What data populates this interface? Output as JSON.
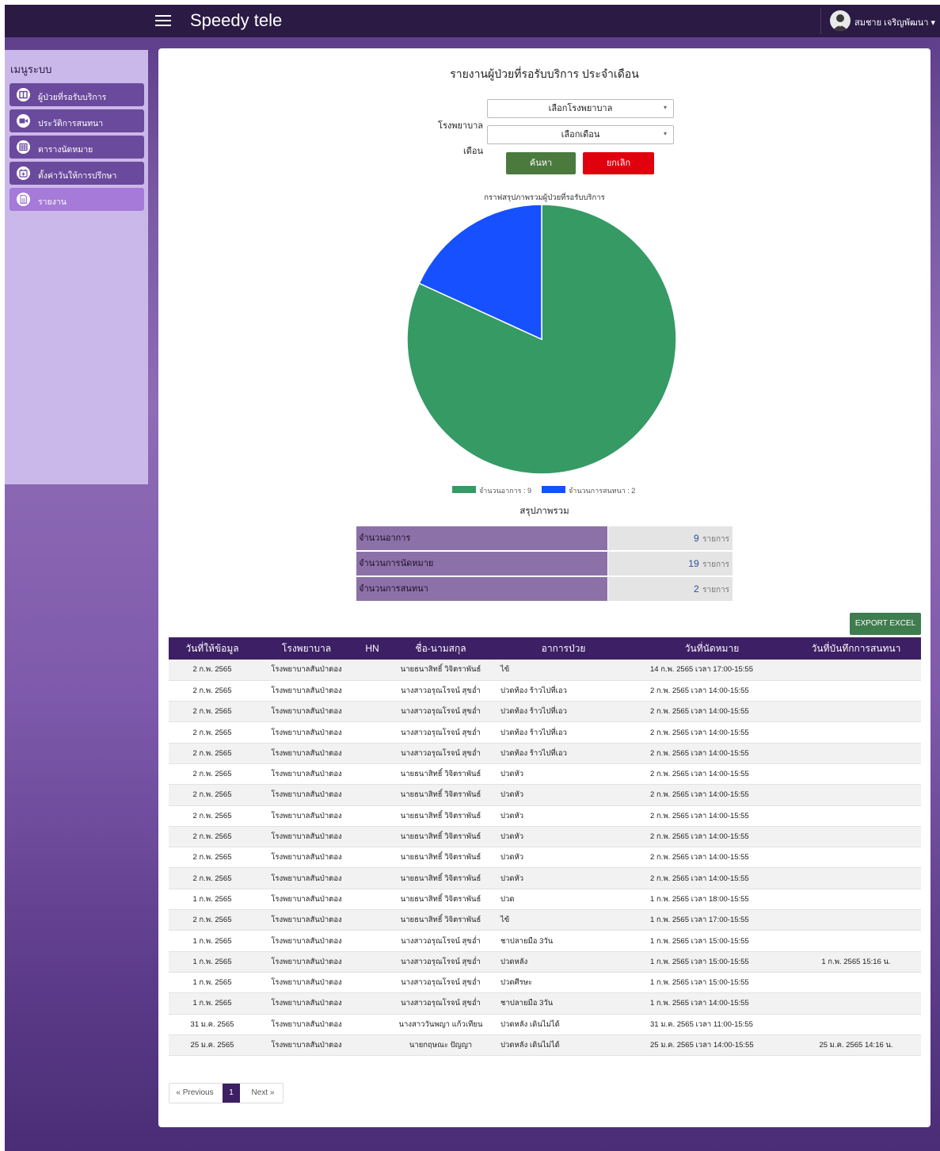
{
  "app": {
    "title": "Speedy tele"
  },
  "user": {
    "name": "สมชาย เจริญพัฒนา ▾"
  },
  "sidebar": {
    "title": "เมนูระบบ",
    "items": [
      {
        "label": "ผู้ป่วยที่รอรับบริการ",
        "icon": "columns-icon"
      },
      {
        "label": "ประวัติการสนทนา",
        "icon": "video-camera-icon"
      },
      {
        "label": "ตารางนัดหมาย",
        "icon": "table-icon"
      },
      {
        "label": "ตั้งค่าวันให้การปรึกษา",
        "icon": "calendar-plus-icon"
      },
      {
        "label": "รายงาน",
        "icon": "document-icon"
      }
    ]
  },
  "report": {
    "title": "รายงานผู้ป่วยที่รอรับบริการ ประจำเดือน",
    "hospital_label": "โรงพยาบาล",
    "hospital_value": "เลือกโรงพยาบาล",
    "month_label": "เดือน",
    "month_value": "เลือกเดือน",
    "search_label": "ค้นหา",
    "cancel_label": "ยกเลิก"
  },
  "chart_data": {
    "type": "pie",
    "title": "กราฟสรุปภาพรวมผู้ป่วยที่รอรับบริการ",
    "slices": [
      {
        "label": "จำนวนอาการ : 9",
        "value": 9,
        "color": "#369a65"
      },
      {
        "label": "จำนวนการสนทนา : 2",
        "value": 2,
        "color": "#1650ff"
      }
    ],
    "legend_position": "bottom"
  },
  "summary": {
    "title": "สรุปภาพรวม",
    "unit": "รายการ",
    "rows": [
      {
        "label": "จำนวนอาการ",
        "value": "9"
      },
      {
        "label": "จำนวนการนัดหมาย",
        "value": "19"
      },
      {
        "label": "จำนวนการสนทนา",
        "value": "2"
      }
    ]
  },
  "export_label": "EXPORT EXCEL",
  "table": {
    "headers": [
      "วันที่ให้ข้อมูล",
      "โรงพยาบาล",
      "HN",
      "ชื่อ-นามสกุล",
      "อาการป่วย",
      "วันที่นัดหมาย",
      "วันที่บันทึกการสนทนา"
    ],
    "rows": [
      [
        "2 ก.พ. 2565",
        "โรงพยาบาลสันป่าตอง",
        "",
        "นายธนาสิทธิ์ วิจิตราพันธ์",
        "ไข้",
        "14 ก.พ. 2565 เวลา 17:00-15:55",
        ""
      ],
      [
        "2 ก.พ. 2565",
        "โรงพยาบาลสันป่าตอง",
        "",
        "นางสาวอรุณโรจน์ สุขอ่ำ",
        "ปวดท้อง ร้าวไปที่เอว",
        "2 ก.พ. 2565 เวลา 14:00-15:55",
        ""
      ],
      [
        "2 ก.พ. 2565",
        "โรงพยาบาลสันป่าตอง",
        "",
        "นางสาวอรุณโรจน์ สุขอ่ำ",
        "ปวดท้อง ร้าวไปที่เอว",
        "2 ก.พ. 2565 เวลา 14:00-15:55",
        ""
      ],
      [
        "2 ก.พ. 2565",
        "โรงพยาบาลสันป่าตอง",
        "",
        "นางสาวอรุณโรจน์ สุขอ่ำ",
        "ปวดท้อง ร้าวไปที่เอว",
        "2 ก.พ. 2565 เวลา 14:00-15:55",
        ""
      ],
      [
        "2 ก.พ. 2565",
        "โรงพยาบาลสันป่าตอง",
        "",
        "นางสาวอรุณโรจน์ สุขอ่ำ",
        "ปวดท้อง ร้าวไปที่เอว",
        "2 ก.พ. 2565 เวลา 14:00-15:55",
        ""
      ],
      [
        "2 ก.พ. 2565",
        "โรงพยาบาลสันป่าตอง",
        "",
        "นายธนาสิทธิ์ วิจิตราพันธ์",
        "ปวดหัว",
        "2 ก.พ. 2565 เวลา 14:00-15:55",
        ""
      ],
      [
        "2 ก.พ. 2565",
        "โรงพยาบาลสันป่าตอง",
        "",
        "นายธนาสิทธิ์ วิจิตราพันธ์",
        "ปวดหัว",
        "2 ก.พ. 2565 เวลา 14:00-15:55",
        ""
      ],
      [
        "2 ก.พ. 2565",
        "โรงพยาบาลสันป่าตอง",
        "",
        "นายธนาสิทธิ์ วิจิตราพันธ์",
        "ปวดหัว",
        "2 ก.พ. 2565 เวลา 14:00-15:55",
        ""
      ],
      [
        "2 ก.พ. 2565",
        "โรงพยาบาลสันป่าตอง",
        "",
        "นายธนาสิทธิ์ วิจิตราพันธ์",
        "ปวดหัว",
        "2 ก.พ. 2565 เวลา 14:00-15:55",
        ""
      ],
      [
        "2 ก.พ. 2565",
        "โรงพยาบาลสันป่าตอง",
        "",
        "นายธนาสิทธิ์ วิจิตราพันธ์",
        "ปวดหัว",
        "2 ก.พ. 2565 เวลา 14:00-15:55",
        ""
      ],
      [
        "2 ก.พ. 2565",
        "โรงพยาบาลสันป่าตอง",
        "",
        "นายธนาสิทธิ์ วิจิตราพันธ์",
        "ปวดหัว",
        "2 ก.พ. 2565 เวลา 14:00-15:55",
        ""
      ],
      [
        "1 ก.พ. 2565",
        "โรงพยาบาลสันป่าตอง",
        "",
        "นายธนาสิทธิ์ วิจิตราพันธ์",
        "ปวด",
        "1 ก.พ. 2565 เวลา 18:00-15:55",
        ""
      ],
      [
        "2 ก.พ. 2565",
        "โรงพยาบาลสันป่าตอง",
        "",
        "นายธนาสิทธิ์ วิจิตราพันธ์",
        "ไข้",
        "1 ก.พ. 2565 เวลา 17:00-15:55",
        ""
      ],
      [
        "1 ก.พ. 2565",
        "โรงพยาบาลสันป่าตอง",
        "",
        "นางสาวอรุณโรจน์ สุขอ่ำ",
        "ชาปลายมือ 3วัน",
        "1 ก.พ. 2565 เวลา 15:00-15:55",
        ""
      ],
      [
        "1 ก.พ. 2565",
        "โรงพยาบาลสันป่าตอง",
        "",
        "นางสาวอรุณโรจน์ สุขอ่ำ",
        "ปวดหลัง",
        "1 ก.พ. 2565 เวลา 15:00-15:55",
        "1 ก.พ. 2565 15:16 น."
      ],
      [
        "1 ก.พ. 2565",
        "โรงพยาบาลสันป่าตอง",
        "",
        "นางสาวอรุณโรจน์ สุขอ่ำ",
        "ปวดศีรษะ",
        "1 ก.พ. 2565 เวลา 15:00-15:55",
        ""
      ],
      [
        "1 ก.พ. 2565",
        "โรงพยาบาลสันป่าตอง",
        "",
        "นางสาวอรุณโรจน์ สุขอ่ำ",
        "ชาปลายมือ 3วัน",
        "1 ก.พ. 2565 เวลา 14:00-15:55",
        ""
      ],
      [
        "31 ม.ค. 2565",
        "โรงพยาบาลสันป่าตอง",
        "",
        "นางสาววันพญา แก้วเทียน",
        "ปวดหลัง เดินไม่ได้",
        "31 ม.ค. 2565 เวลา 11:00-15:55",
        ""
      ],
      [
        "25 ม.ค. 2565",
        "โรงพยาบาลสันป่าตอง",
        "",
        "นายกฤษณะ ปัญญา",
        "ปวดหลัง เดินไม่ได้",
        "25 ม.ค. 2565 เวลา 14:00-15:55",
        "25 ม.ค. 2565 14:16 น."
      ]
    ]
  },
  "pagination": {
    "previous": "« Previous",
    "current": "1",
    "next": "Next »"
  },
  "colors": {
    "topbar": "#2a1a44",
    "sidebar": "#cbb8ea",
    "sidebar_item": "#6a4a9c",
    "sidebar_item_active": "#a57ad8",
    "search_button": "#4a7a3e",
    "cancel_button": "#e1000e",
    "table_header": "#3c1f64",
    "export_button": "#3f7c4e",
    "page_active": "#3c1f64"
  }
}
